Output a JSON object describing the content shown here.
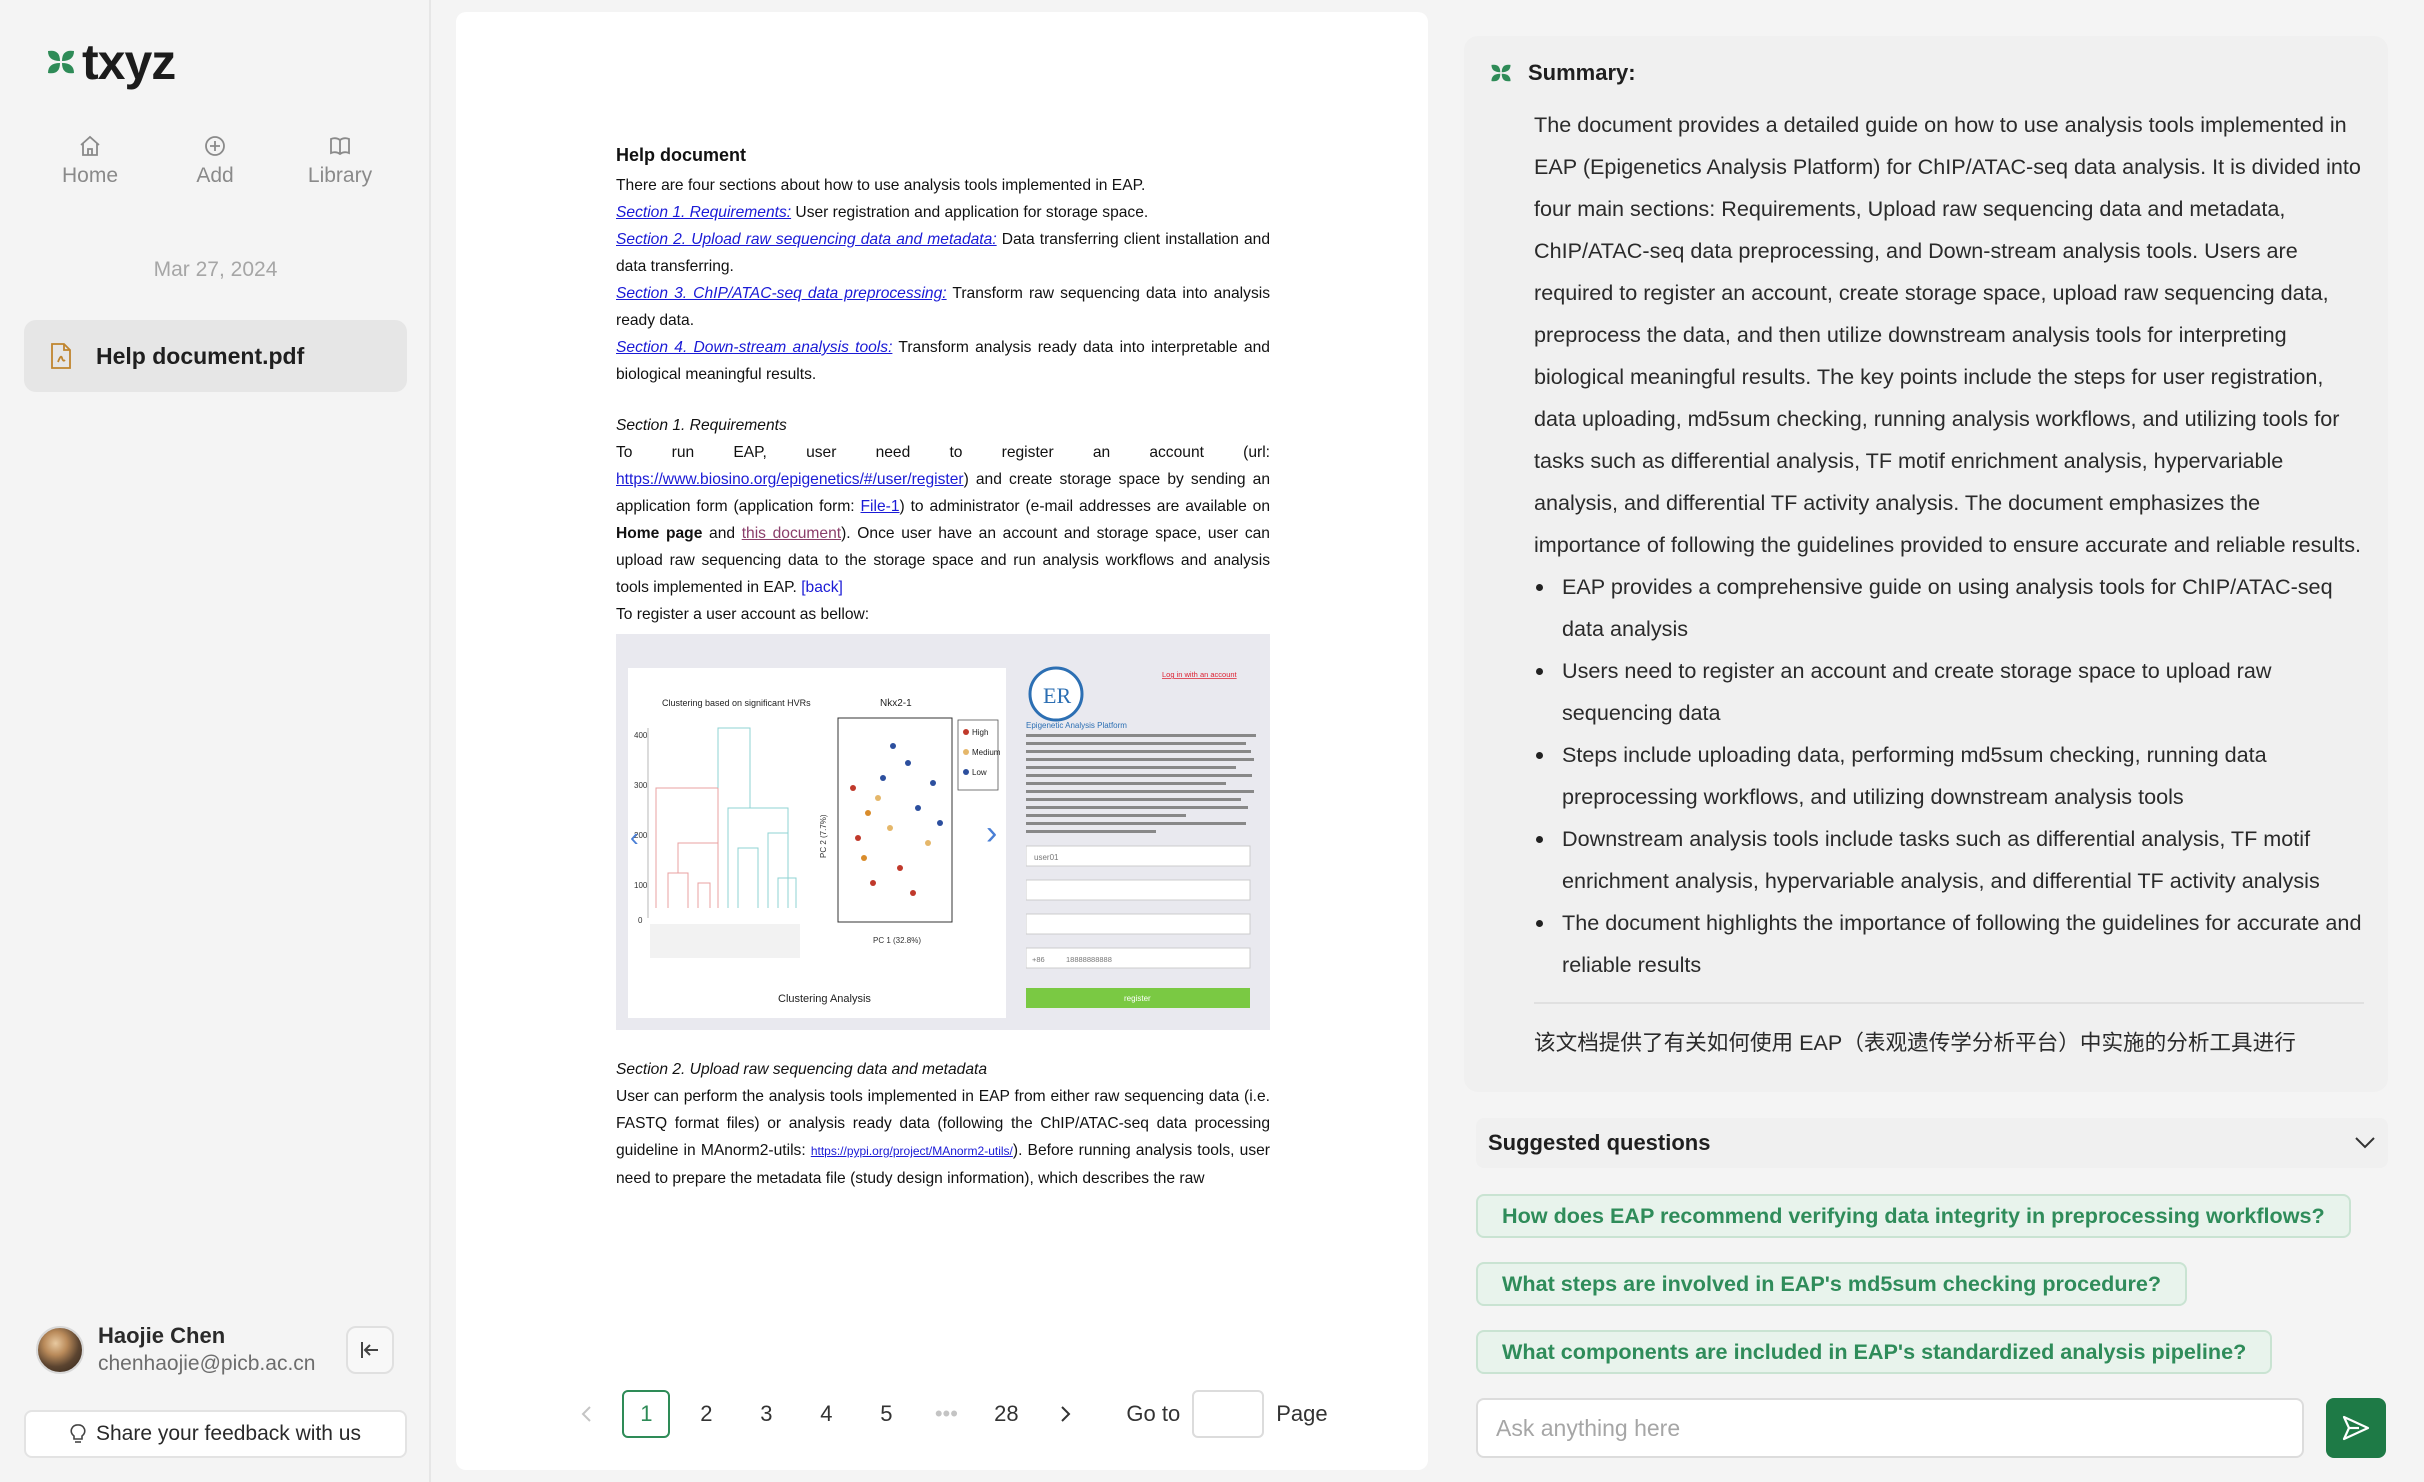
{
  "app": {
    "logo_text": "txyz"
  },
  "nav": [
    {
      "label": "Home",
      "icon": "home-icon"
    },
    {
      "label": "Add",
      "icon": "plus-circle-icon"
    },
    {
      "label": "Library",
      "icon": "book-icon"
    }
  ],
  "sidebar": {
    "date": "Mar 27, 2024",
    "documents": [
      {
        "name": "Help document.pdf",
        "icon": "pdf-file-icon"
      }
    ],
    "user": {
      "name": "Haojie Chen",
      "email": "chenhaojie@picb.ac.cn"
    },
    "feedback_label": "Share your feedback with us"
  },
  "document": {
    "heading": "Help document",
    "intro": "There are four sections about how to use analysis tools implemented in EAP.",
    "toc": [
      {
        "link": "Section 1. Requirements:",
        "text": " User registration and application for storage space."
      },
      {
        "link": "Section 2. Upload raw sequencing data and metadata:",
        "text": " Data transferring client installation and data transferring."
      },
      {
        "link": "Section 3. ChIP/ATAC-seq data preprocessing:",
        "text": " Transform raw sequencing data into analysis ready data."
      },
      {
        "link": "Section 4. Down-stream analysis tools:",
        "text": " Transform analysis ready data into interpretable and biological meaningful results."
      }
    ],
    "sec1_title": "Section 1. Requirements",
    "sec1_a": "To run EAP, user need to register an account (url: ",
    "sec1_url": "https://www.biosino.org/epigenetics/#/user/register",
    "sec1_b": ") and create storage space by sending an application form (application form: ",
    "sec1_file": "File-1",
    "sec1_c": ") to administrator (e-mail addresses are available on ",
    "sec1_home": "Home page",
    "sec1_d": " and ",
    "sec1_this": "this document",
    "sec1_e": "). Once user have an account and storage space, user can upload raw sequencing data to the storage space and run analysis workflows and analysis tools implemented in EAP. ",
    "sec1_back": "[back]",
    "register_line": "To register a user account as bellow:",
    "figure": {
      "left_title": "Clustering based on significant HVRs",
      "mid_title": "Nkx2-1",
      "caption": "Clustering Analysis",
      "legend": [
        "High",
        "Medium",
        "Low"
      ],
      "ylabel": "PC 2 (7.7%)",
      "xlabel": "PC 1 (32.8%)",
      "login_link": "Log in with an account",
      "platform": "Epigenetic Analysis Platform",
      "logo": "ER",
      "register_btn": "register",
      "field_user": "user01",
      "phone_prefix": "+86",
      "phone": "18888888888"
    },
    "sec2_title": "Section 2. Upload raw sequencing data and metadata",
    "sec2_a": "User can perform the analysis tools implemented in EAP from either raw sequencing data (i.e. FASTQ format files) or analysis ready data (following the ChIP/ATAC-seq data processing guideline in MAnorm2-utils: ",
    "sec2_link": "https://pypi.org/project/MAnorm2-utils/",
    "sec2_b": "). Before running analysis tools, user need to prepare the metadata file (study design information), which describes the raw"
  },
  "pagination": {
    "pages": [
      "1",
      "2",
      "3",
      "4",
      "5",
      "•••",
      "28"
    ],
    "current": "1",
    "goto_label": "Go to",
    "page_label": "Page"
  },
  "summary": {
    "title": "Summary:",
    "paragraph": "The document provides a detailed guide on how to use analysis tools implemented in EAP (Epigenetics Analysis Platform) for ChIP/ATAC-seq data analysis. It is divided into four main sections: Requirements, Upload raw sequencing data and metadata, ChIP/ATAC-seq data preprocessing, and Down-stream analysis tools. Users are required to register an account, create storage space, upload raw sequencing data, preprocess the data, and then utilize downstream analysis tools for interpreting biological meaningful results. The key points include the steps for user registration, data uploading, md5sum checking, running analysis workflows, and utilizing tools for tasks such as differential analysis, TF motif enrichment analysis, hypervariable analysis, and differential TF activity analysis. The document emphasizes the importance of following the guidelines provided to ensure accurate and reliable results.",
    "bullets": [
      "EAP provides a comprehensive guide on using analysis tools for ChIP/ATAC-seq data analysis",
      "Users need to register an account and create storage space to upload raw sequencing data",
      "Steps include uploading data, performing md5sum checking, running data preprocessing workflows, and utilizing downstream analysis tools",
      "Downstream analysis tools include tasks such as differential analysis, TF motif enrichment analysis, hypervariable analysis, and differential TF activity analysis",
      "The document highlights the importance of following the guidelines for accurate and reliable results"
    ],
    "chinese": "该文档提供了有关如何使用 EAP（表观遗传学分析平台）中实施的分析工具进行"
  },
  "suggested": {
    "title": "Suggested questions",
    "questions": [
      "How does EAP recommend verifying data integrity in preprocessing workflows?",
      "What steps are involved in EAP's md5sum checking procedure?",
      "What components are included in EAP's standardized analysis pipeline?"
    ]
  },
  "chat": {
    "placeholder": "Ask anything here"
  },
  "colors": {
    "accent": "#2e8b57",
    "send": "#1e7a46",
    "chip_bg": "#e8f3ec"
  }
}
